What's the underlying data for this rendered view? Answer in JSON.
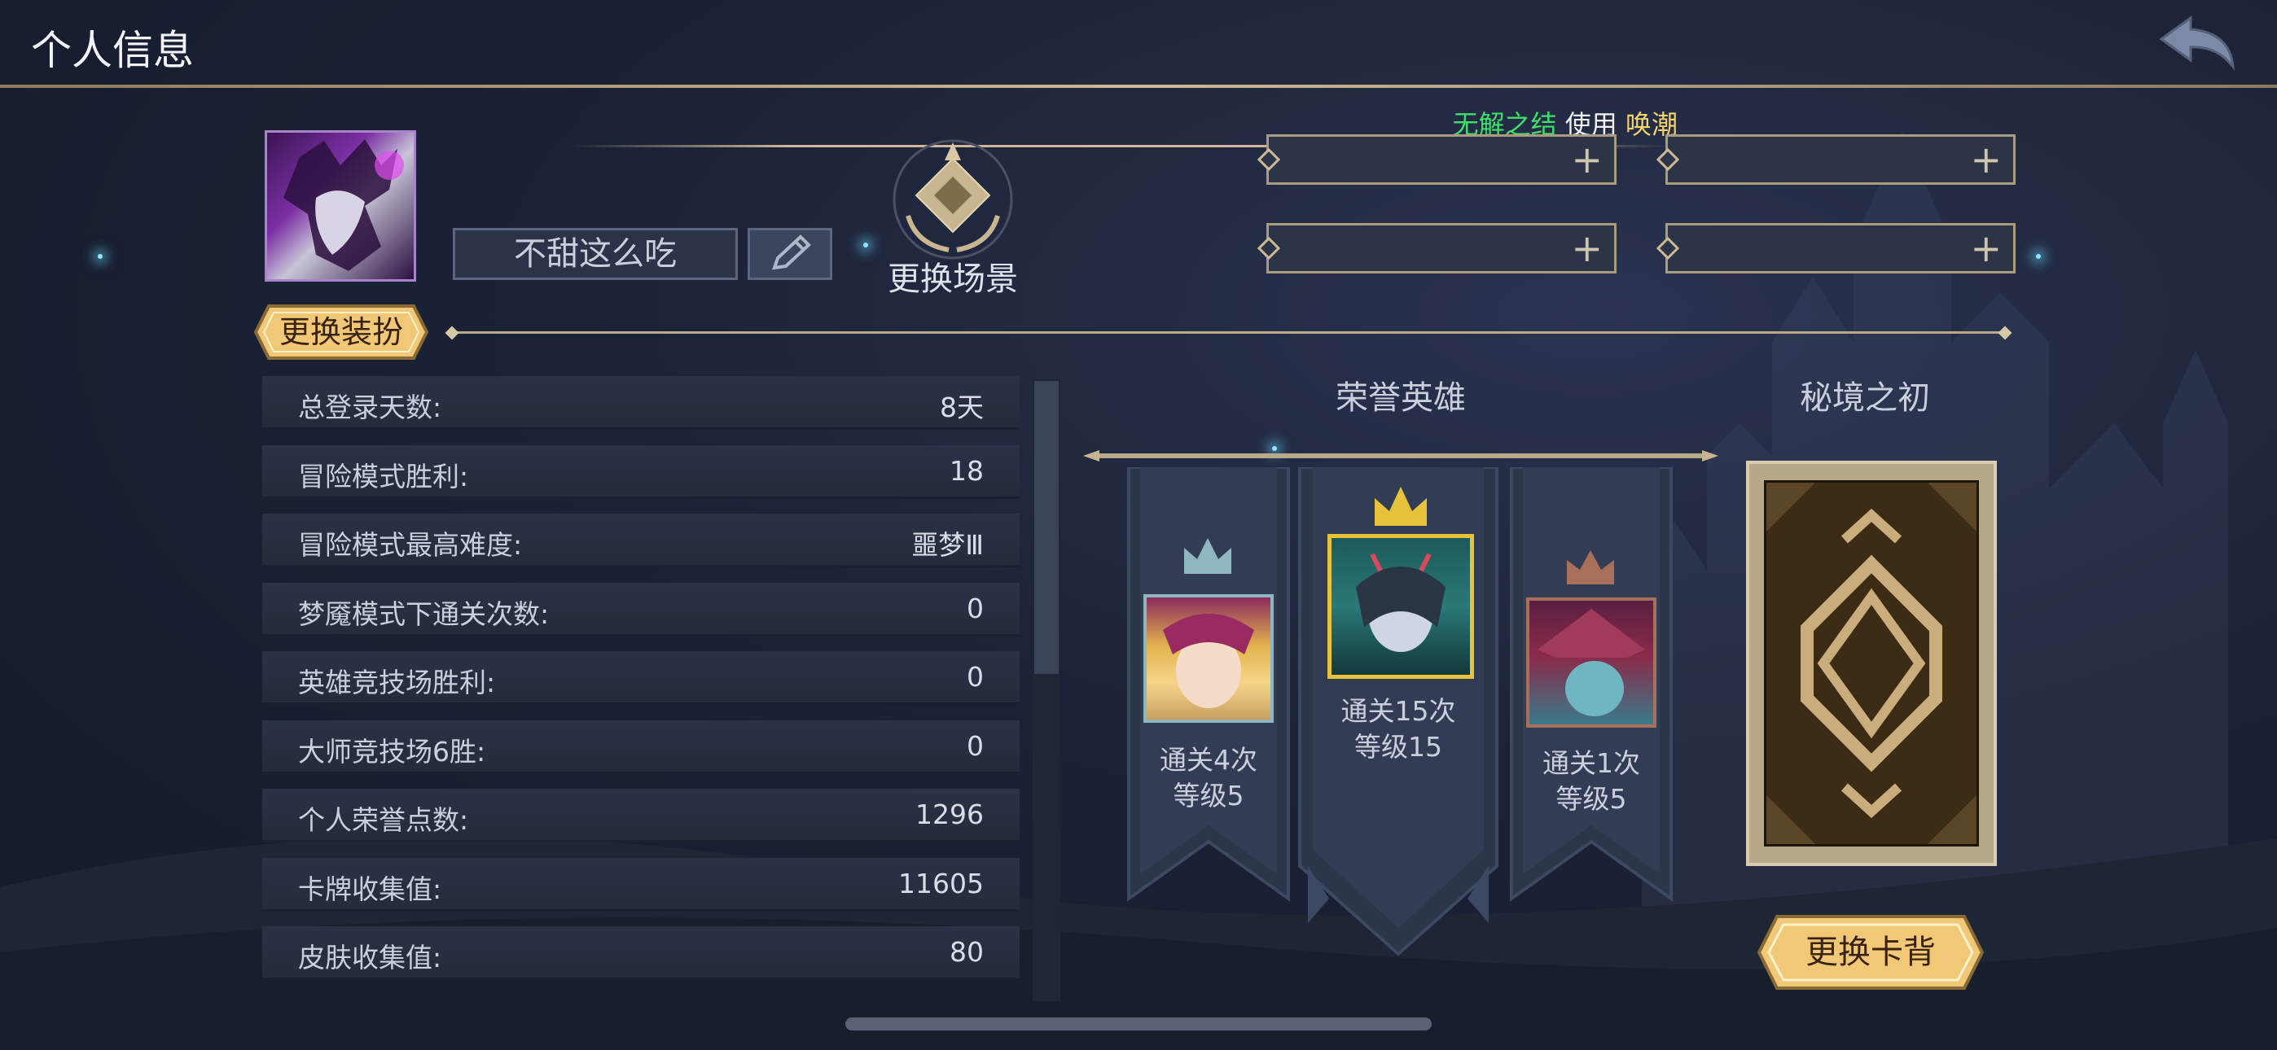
{
  "header": {
    "title": "个人信息",
    "back_icon": "back-arrow-icon"
  },
  "ticker": {
    "part1": "无解之结",
    "part2": "使用",
    "part3": "唤潮"
  },
  "profile": {
    "player_name": "不甜这么吃",
    "edit_icon": "pencil-icon"
  },
  "scene": {
    "label": "更换场景",
    "icon": "chessboard-scene-icon"
  },
  "outfit": {
    "button_label": "更换装扮"
  },
  "slots": [
    {
      "icon": "plus-icon",
      "symbol": "+"
    },
    {
      "icon": "plus-icon",
      "symbol": "+"
    },
    {
      "icon": "plus-icon",
      "symbol": "+"
    },
    {
      "icon": "plus-icon",
      "symbol": "+"
    }
  ],
  "stats": [
    {
      "label": "总登录天数:",
      "value": "8天"
    },
    {
      "label": "冒险模式胜利:",
      "value": "18"
    },
    {
      "label": "冒险模式最高难度:",
      "value": "噩梦Ⅲ"
    },
    {
      "label": "梦魇模式下通关次数:",
      "value": "0"
    },
    {
      "label": "英雄竞技场胜利:",
      "value": "0"
    },
    {
      "label": "大师竞技场6胜:",
      "value": "0"
    },
    {
      "label": "个人荣誉点数:",
      "value": "1296"
    },
    {
      "label": "卡牌收集值:",
      "value": "11605"
    },
    {
      "label": "皮肤收集值:",
      "value": "80"
    }
  ],
  "honor_heroes": {
    "title": "荣誉英雄",
    "heroes": [
      {
        "rank": 2,
        "crown_color": "#8fb7c2",
        "line1": "通关4次",
        "line2": "等级5"
      },
      {
        "rank": 1,
        "crown_color": "#e8c23a",
        "line1": "通关15次",
        "line2": "等级15"
      },
      {
        "rank": 3,
        "crown_color": "#a8705a",
        "line1": "通关1次",
        "line2": "等级5"
      }
    ]
  },
  "card_back": {
    "title": "秘境之初",
    "button_label": "更换卡背"
  },
  "colors": {
    "accent_gold": "#cdb995",
    "panel": "#2a3346",
    "button_gold": "#f0c878"
  }
}
